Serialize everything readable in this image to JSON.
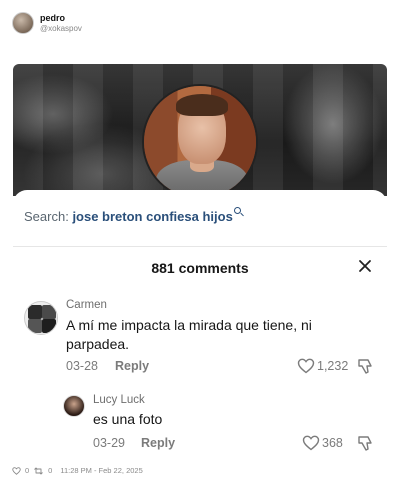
{
  "post": {
    "author_name": "pedro",
    "author_handle": "@xokaspov"
  },
  "embed": {
    "search_label": "Search:",
    "search_query": "jose breton confiesa hijos",
    "comments_count_label": "881 comments",
    "comments": [
      {
        "author": "Carmen",
        "text_line1": "A mí me impacta la mirada que tiene, ni",
        "text_line2": "parpadea.",
        "date": "03-28",
        "reply_label": "Reply",
        "likes": "1,232"
      },
      {
        "author": "Lucy Luck",
        "text_line1": "es una foto",
        "date": "03-29",
        "reply_label": "Reply",
        "likes": "368"
      }
    ]
  },
  "footer": {
    "likes": "0",
    "reposts": "0",
    "timestamp": "11:28 PM - Feb 22, 2025"
  }
}
